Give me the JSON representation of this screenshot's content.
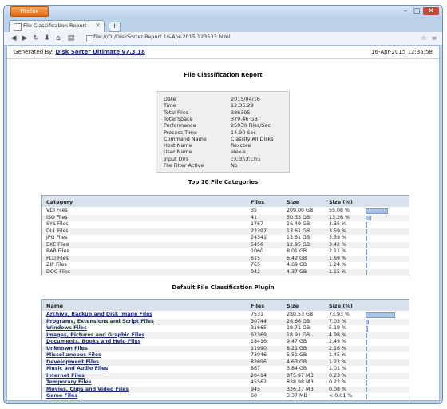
{
  "browser": {
    "app_button": "Firefox",
    "tab_title": "File Classification Report",
    "url": "file:///D:/DiskSorter Report 16-Apr-2015 123533.html",
    "new_tab_symbol": "+",
    "tab_close_symbol": "×"
  },
  "header": {
    "generated_label": "Generated By:",
    "generator": "Disk Sorter Ultimate v7.3.18",
    "date": "16-Apr-2015 12:35:58"
  },
  "report": {
    "title": "File Classification Report",
    "summary": [
      {
        "label": "Date",
        "value": "2015/04/16"
      },
      {
        "label": "Time",
        "value": "12:35:29"
      },
      {
        "label": "Total Files",
        "value": "386305"
      },
      {
        "label": "Total Space",
        "value": "379.46 GB"
      },
      {
        "label": "Performance",
        "value": "25930 Files/Sec"
      },
      {
        "label": "Process Time",
        "value": "14.90 Sec"
      },
      {
        "label": "Command Name",
        "value": "Classify All Disks"
      },
      {
        "label": "Host Name",
        "value": "flexcore"
      },
      {
        "label": "User Name",
        "value": "alex-s"
      },
      {
        "label": "Input Dirs",
        "value": "c:\\;d:\\;f:\\;h:\\"
      },
      {
        "label": "File Filter Active",
        "value": "No"
      }
    ]
  },
  "top_categories": {
    "title": "Top 10 File Categories",
    "columns": [
      "Category",
      "Files",
      "Size",
      "Size (%)"
    ],
    "rows": [
      {
        "name": "VDI Files",
        "files": "35",
        "size": "209.00 GB",
        "pct": "55.08 %",
        "fraction": 0.5508
      },
      {
        "name": "ISO Files",
        "files": "41",
        "size": "50.33 GB",
        "pct": "13.26 %",
        "fraction": 0.1326
      },
      {
        "name": "SYS Files",
        "files": "1767",
        "size": "16.49 GB",
        "pct": "4.35 %",
        "fraction": 0.0435
      },
      {
        "name": "DLL Files",
        "files": "22397",
        "size": "13.61 GB",
        "pct": "3.59 %",
        "fraction": 0.0359
      },
      {
        "name": "JPG Files",
        "files": "24341",
        "size": "13.61 GB",
        "pct": "3.59 %",
        "fraction": 0.0359
      },
      {
        "name": "EXE Files",
        "files": "5456",
        "size": "12.95 GB",
        "pct": "3.42 %",
        "fraction": 0.0342
      },
      {
        "name": "RAR Files",
        "files": "1060",
        "size": "8.01 GB",
        "pct": "2.11 %",
        "fraction": 0.0211
      },
      {
        "name": "FLD Files",
        "files": "615",
        "size": "6.42 GB",
        "pct": "1.69 %",
        "fraction": 0.0169
      },
      {
        "name": "ZIP Files",
        "files": "765",
        "size": "4.69 GB",
        "pct": "1.24 %",
        "fraction": 0.0124
      },
      {
        "name": "DOC Files",
        "files": "942",
        "size": "4.37 GB",
        "pct": "1.15 %",
        "fraction": 0.0115
      }
    ]
  },
  "plugin": {
    "title": "Default File Classification Plugin",
    "columns": [
      "Name",
      "Files",
      "Size",
      "Size (%)"
    ],
    "rows": [
      {
        "name": "Archive, Backup and Disk Image Files",
        "files": "7531",
        "size": "280.53 GB",
        "pct": "73.93 %",
        "fraction": 0.7393
      },
      {
        "name": "Programs, Extensions and Script Files",
        "files": "30744",
        "size": "26.66 GB",
        "pct": "7.03 %",
        "fraction": 0.0703
      },
      {
        "name": "Windows Files",
        "files": "31665",
        "size": "19.71 GB",
        "pct": "5.19 %",
        "fraction": 0.0519
      },
      {
        "name": "Images, Pictures and Graphic Files",
        "files": "62369",
        "size": "18.91 GB",
        "pct": "4.98 %",
        "fraction": 0.0498
      },
      {
        "name": "Documents, Books and Help Files",
        "files": "18416",
        "size": "9.47 GB",
        "pct": "2.49 %",
        "fraction": 0.0249
      },
      {
        "name": "Unknown Files",
        "files": "11990",
        "size": "8.21 GB",
        "pct": "2.16 %",
        "fraction": 0.0216
      },
      {
        "name": "Miscellaneous Files",
        "files": "73046",
        "size": "5.51 GB",
        "pct": "1.45 %",
        "fraction": 0.0145
      },
      {
        "name": "Development Files",
        "files": "82696",
        "size": "4.63 GB",
        "pct": "1.22 %",
        "fraction": 0.0122
      },
      {
        "name": "Music and Audio Files",
        "files": "867",
        "size": "3.84 GB",
        "pct": "1.01 %",
        "fraction": 0.0101
      },
      {
        "name": "Internet Files",
        "files": "20414",
        "size": "875.97 MB",
        "pct": "0.23 %",
        "fraction": 0.0023
      },
      {
        "name": "Temporary Files",
        "files": "45562",
        "size": "838.98 MB",
        "pct": "0.22 %",
        "fraction": 0.0022
      },
      {
        "name": "Movies, Clips and Video Files",
        "files": "945",
        "size": "326.27 MB",
        "pct": "0.08 %",
        "fraction": 0.0008
      },
      {
        "name": "Game Files",
        "files": "60",
        "size": "3.37 MB",
        "pct": "< 0.01 %",
        "fraction": 5e-05
      }
    ]
  }
}
